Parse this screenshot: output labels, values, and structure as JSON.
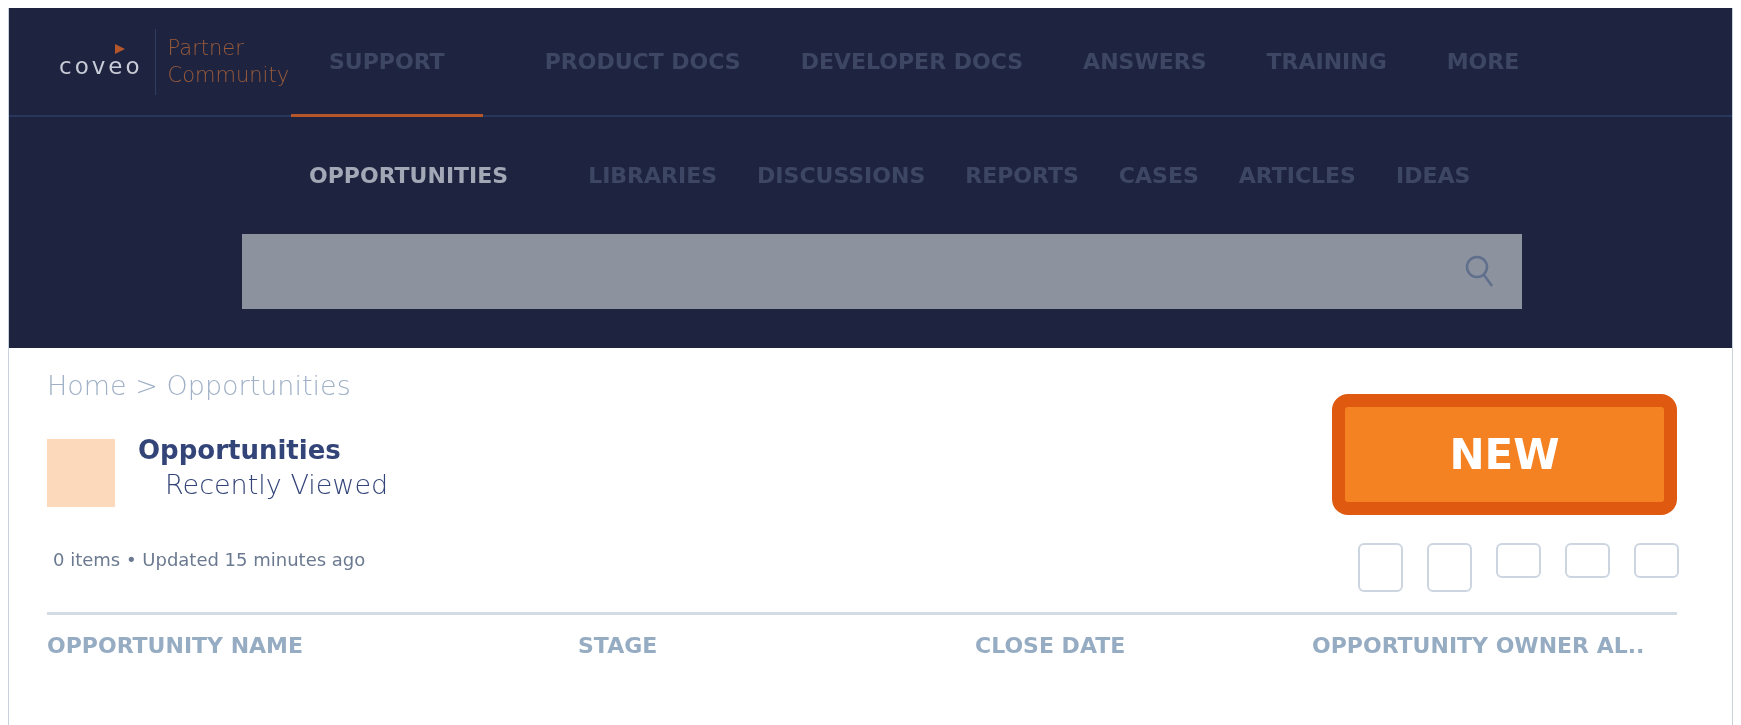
{
  "logo": {
    "wordmark": "coveo",
    "tagline": "Partner Community"
  },
  "main_nav": [
    {
      "label": "SUPPORT",
      "selected": true
    },
    {
      "label": "PRODUCT DOCS",
      "selected": false
    },
    {
      "label": "DEVELOPER DOCS",
      "selected": false
    },
    {
      "label": "ANSWERS",
      "selected": false
    },
    {
      "label": "TRAINING",
      "selected": false
    },
    {
      "label": "MORE",
      "selected": false
    }
  ],
  "sub_nav": [
    {
      "label": "OPPORTUNITIES",
      "selected": true
    },
    {
      "label": "LIBRARIES",
      "selected": false
    },
    {
      "label": "DISCUSSIONS",
      "selected": false
    },
    {
      "label": "REPORTS",
      "selected": false
    },
    {
      "label": "CASES",
      "selected": false
    },
    {
      "label": "ARTICLES",
      "selected": false
    },
    {
      "label": "IDEAS",
      "selected": false
    }
  ],
  "breadcrumb": "Home > Opportunities",
  "list_view": {
    "object": "Opportunities",
    "view": "Recently Viewed",
    "meta": "0 items • Updated 15 minutes ago"
  },
  "new_button": "NEW",
  "table": {
    "columns": [
      "OPPORTUNITY NAME",
      "STAGE",
      "CLOSE DATE",
      "OPPORTUNITY OWNER AL.."
    ]
  }
}
